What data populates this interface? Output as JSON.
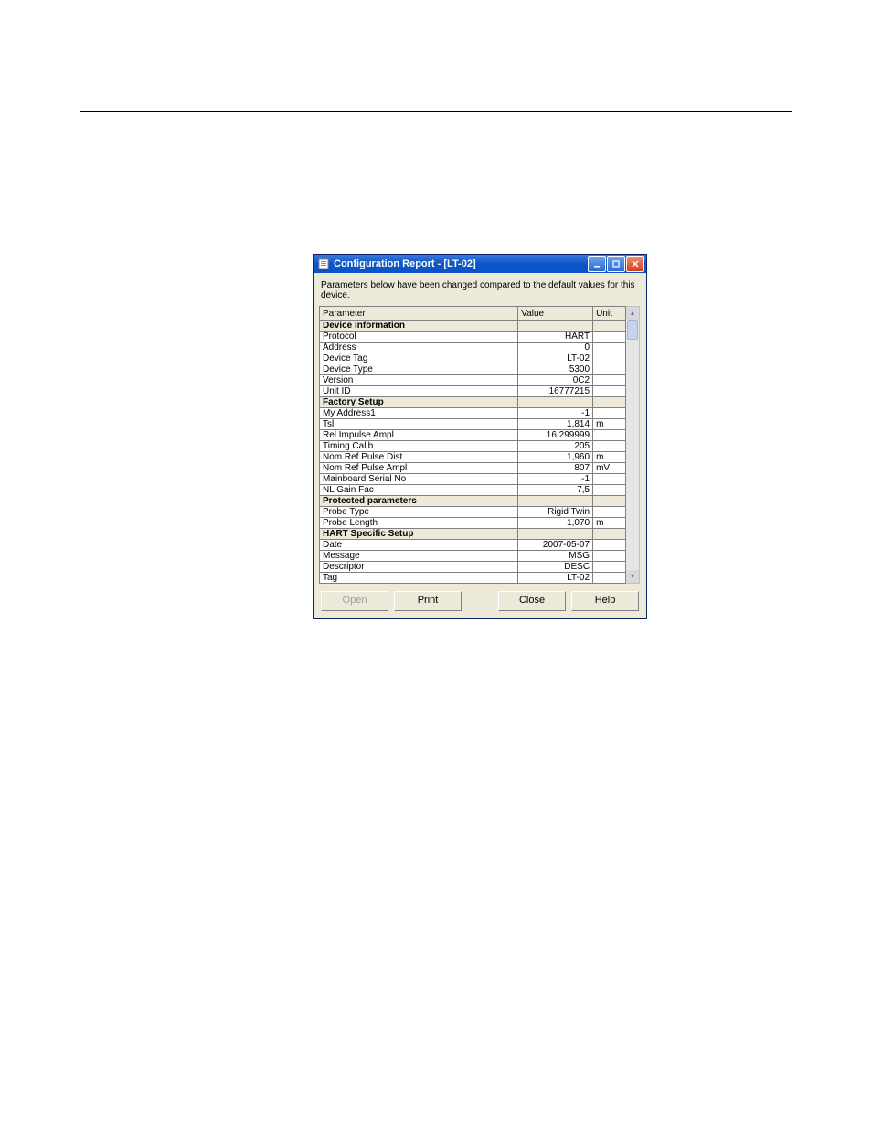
{
  "window": {
    "title": "Configuration Report - [LT-02]",
    "info_text": "Parameters below have been changed compared to the default values for this device.",
    "headers": {
      "parameter": "Parameter",
      "value": "Value",
      "unit": "Unit"
    },
    "sections": [
      {
        "title": "Device Information",
        "rows": [
          {
            "param": "Protocol",
            "value": "HART",
            "unit": ""
          },
          {
            "param": "Address",
            "value": "0",
            "unit": ""
          },
          {
            "param": "Device Tag",
            "value": "LT-02",
            "unit": ""
          },
          {
            "param": "Device Type",
            "value": "5300",
            "unit": ""
          },
          {
            "param": "Version",
            "value": "0C2",
            "unit": ""
          },
          {
            "param": "Unit ID",
            "value": "16777215",
            "unit": ""
          }
        ]
      },
      {
        "title": "Factory Setup",
        "rows": [
          {
            "param": "My Address1",
            "value": "-1",
            "unit": ""
          },
          {
            "param": "Tsl",
            "value": "1,814",
            "unit": "m"
          },
          {
            "param": "Rel Impulse Ampl",
            "value": "16,299999",
            "unit": ""
          },
          {
            "param": "Timing Calib",
            "value": "205",
            "unit": ""
          },
          {
            "param": "Nom Ref Pulse Dist",
            "value": "1,960",
            "unit": "m"
          },
          {
            "param": "Nom Ref Pulse Ampl",
            "value": "807",
            "unit": "mV"
          },
          {
            "param": "Mainboard Serial No",
            "value": "-1",
            "unit": ""
          },
          {
            "param": "NL Gain Fac",
            "value": "7,5",
            "unit": ""
          }
        ]
      },
      {
        "title": "Protected parameters",
        "rows": [
          {
            "param": "Probe Type",
            "value": "Rigid Twin",
            "unit": ""
          },
          {
            "param": "Probe Length",
            "value": "1,070",
            "unit": "m"
          }
        ]
      },
      {
        "title": "HART Specific Setup",
        "rows": [
          {
            "param": "Date",
            "value": "2007-05-07",
            "unit": ""
          },
          {
            "param": "Message",
            "value": "MSG",
            "unit": ""
          },
          {
            "param": "Descriptor",
            "value": "DESC",
            "unit": ""
          },
          {
            "param": "Tag",
            "value": "LT-02",
            "unit": ""
          }
        ]
      }
    ],
    "buttons": {
      "open": "Open",
      "print": "Print",
      "close": "Close",
      "help": "Help"
    }
  }
}
